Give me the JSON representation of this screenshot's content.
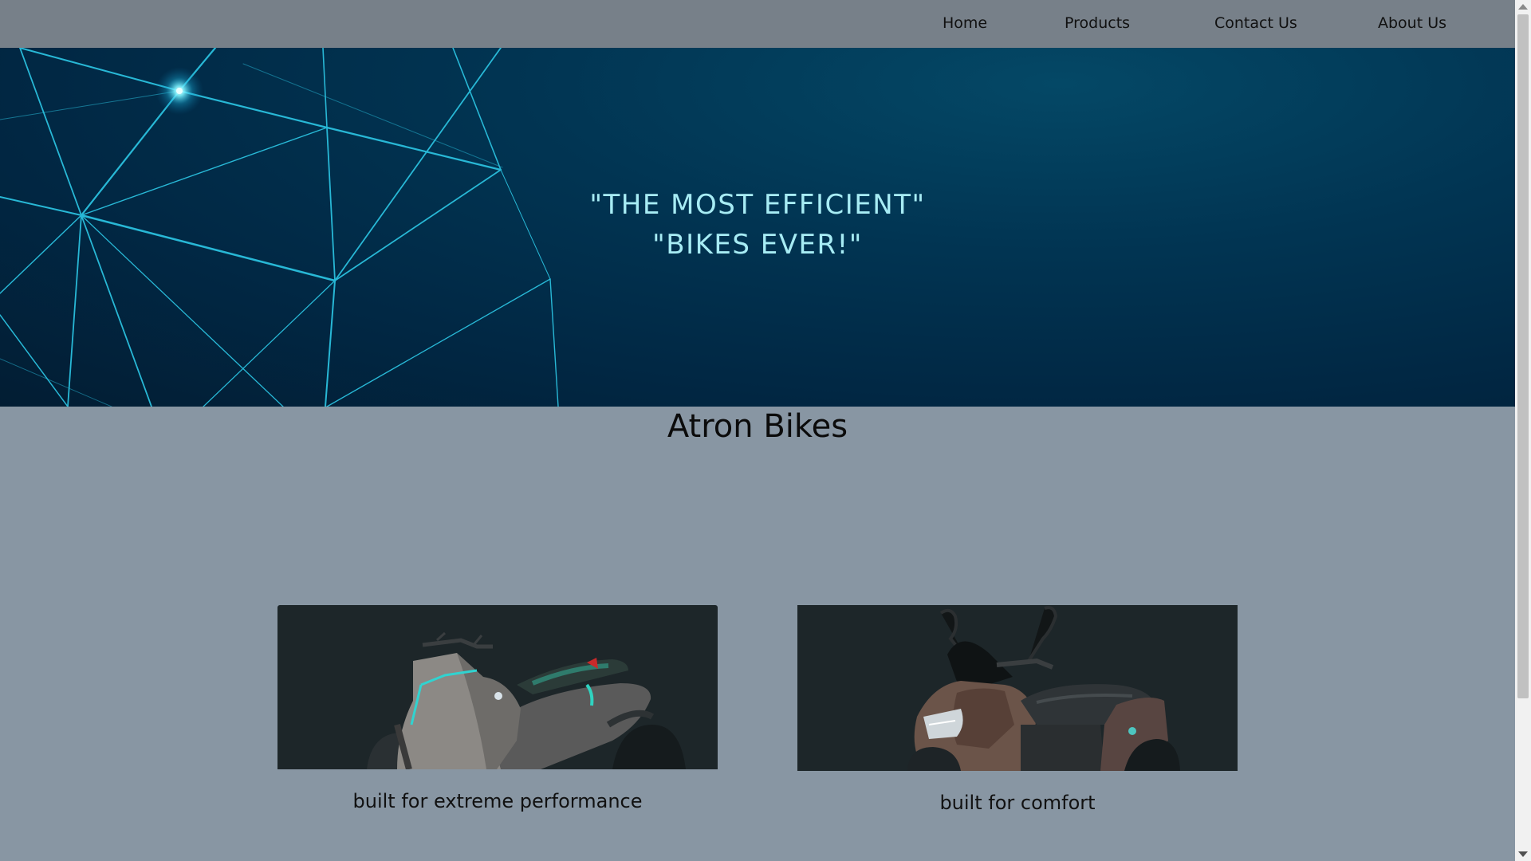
{
  "nav": {
    "items": [
      {
        "label": "Home"
      },
      {
        "label": "Products"
      },
      {
        "label": "Contact Us"
      },
      {
        "label": "About Us"
      }
    ]
  },
  "hero": {
    "tagline_line1": "\"THE MOST EFFICIENT\"",
    "tagline_line2": "\"BIKES EVER!\""
  },
  "main": {
    "heading": "Atron Bikes",
    "products": [
      {
        "caption": "built for extreme performance",
        "image": "electric scooter"
      },
      {
        "caption": "built for comfort",
        "image": "maxi scooter"
      }
    ]
  },
  "colors": {
    "nav_bg": "#778089",
    "page_bg": "#8896a3",
    "hero_bg": "#013553",
    "hero_text": "#a7ecf4",
    "card_bg": "#1d2629"
  }
}
